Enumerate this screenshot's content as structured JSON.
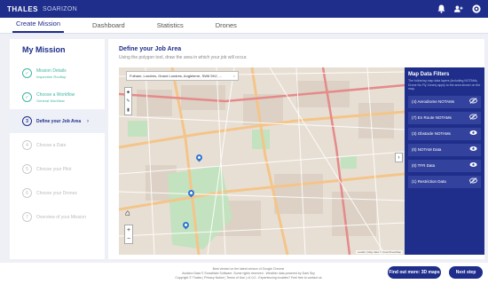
{
  "header": {
    "brand": "THALES",
    "product": "SOARIZON"
  },
  "tabs": [
    {
      "label": "Create Mission",
      "active": true
    },
    {
      "label": "Dashboard"
    },
    {
      "label": "Statistics"
    },
    {
      "label": "Drones"
    }
  ],
  "sidebar": {
    "title": "My Mission",
    "steps": [
      {
        "num": "1",
        "label": "Mission Details",
        "sub": "Inspection Rooftop",
        "state": "done"
      },
      {
        "num": "2",
        "label": "Choose a Workflow",
        "sub": "General Workflow",
        "state": "done"
      },
      {
        "num": "3",
        "label": "Define your Job Area",
        "arrow": "›",
        "state": "active"
      },
      {
        "num": "4",
        "label": "Choose a Date",
        "state": "pending"
      },
      {
        "num": "5",
        "label": "Choose your Pilot",
        "state": "pending"
      },
      {
        "num": "6",
        "label": "Choose your Drones",
        "state": "pending"
      },
      {
        "num": "7",
        "label": "Overview of your Mission",
        "state": "pending"
      }
    ]
  },
  "main": {
    "title": "Define your Job Area",
    "subtitle": "Using the polygon tool, draw the area in which your job will occur."
  },
  "map": {
    "search_value": "Fulham, Londres, Grand Londres, Angleterre, SW6 5HJ, ...",
    "attribution": "Leaflet | Map data © OpenStreetMap"
  },
  "filters": {
    "title": "Map Data Filters",
    "description": "The following map data layers (including NOTAMs, Drone No Fly Zones) apply to the area shown on the map.",
    "items": [
      {
        "label": "(4) Aerodrome NOTAMs",
        "visible": false
      },
      {
        "label": "(7) En Route NOTAMs",
        "visible": false
      },
      {
        "label": "(3) Obstacle NOTAMs",
        "visible": true
      },
      {
        "label": "(0) NOTAM Data",
        "visible": true
      },
      {
        "label": "(0) TFR Data",
        "visible": true
      },
      {
        "label": "(1) Restriction Data",
        "visible": false
      }
    ]
  },
  "footer": {
    "line1": "Best viewed on the latest version of Google Chrome",
    "line2": "Aviation Data © Snowflake Software. Some rights reserved - Weather data powered by Dark Sky",
    "line3": "Copyright © Thales | Privacy Notice | Terms of Use | v1.0.0 - Experiencing troubles? Feel free to contact us",
    "find_out_more": "Find out more: 3D maps",
    "next_step": "Next step"
  },
  "colors": {
    "primary": "#1e2e8a",
    "done": "#3fb6a0",
    "pin": "#2f74d2",
    "park": "#b7dcb5"
  }
}
